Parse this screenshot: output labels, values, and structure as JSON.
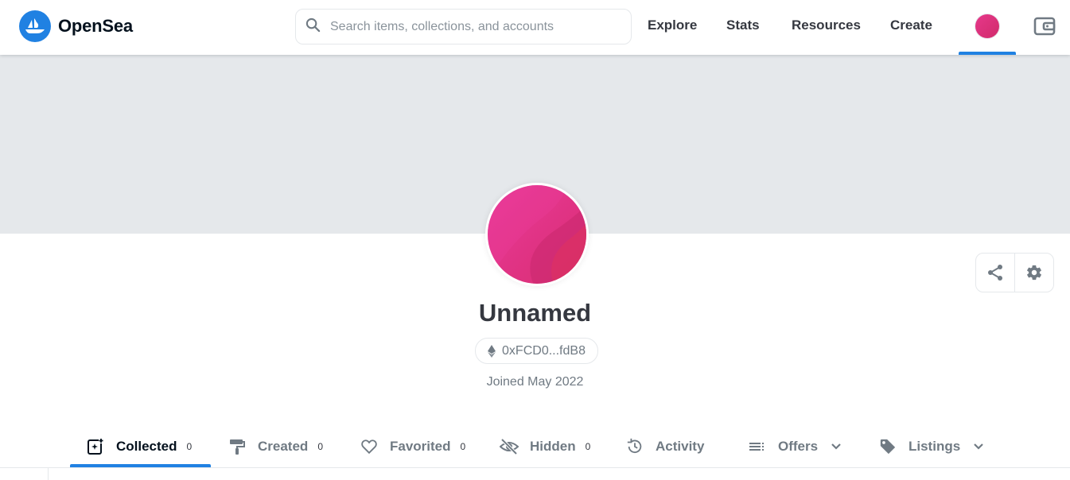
{
  "header": {
    "brand": "OpenSea",
    "search_placeholder": "Search items, collections, and accounts",
    "nav": [
      {
        "label": "Explore"
      },
      {
        "label": "Stats"
      },
      {
        "label": "Resources"
      },
      {
        "label": "Create"
      }
    ],
    "icons": {
      "logo": "opensea-logo-icon",
      "search": "search-icon",
      "avatar": "profile-avatar-icon",
      "wallet": "wallet-icon"
    },
    "accent_color": "#2081e2"
  },
  "profile": {
    "name": "Unnamed",
    "address": "0xFCD0...fdB8",
    "address_icon": "ethereum-icon",
    "joined": "Joined May 2022",
    "avatar_gradient": [
      "#e6388b",
      "#d12b6b"
    ],
    "actions": [
      {
        "icon": "share-icon"
      },
      {
        "icon": "gear-icon"
      }
    ]
  },
  "tabs": [
    {
      "label": "Collected",
      "count": "0",
      "icon": "collected-icon",
      "active": true
    },
    {
      "label": "Created",
      "count": "0",
      "icon": "paint-roller-icon"
    },
    {
      "label": "Favorited",
      "count": "0",
      "icon": "heart-icon"
    },
    {
      "label": "Hidden",
      "count": "0",
      "icon": "eye-off-icon"
    },
    {
      "label": "Activity",
      "icon": "history-icon"
    },
    {
      "label": "Offers",
      "icon": "list-icon",
      "dropdown": true
    },
    {
      "label": "Listings",
      "icon": "tag-icon",
      "dropdown": true
    }
  ]
}
